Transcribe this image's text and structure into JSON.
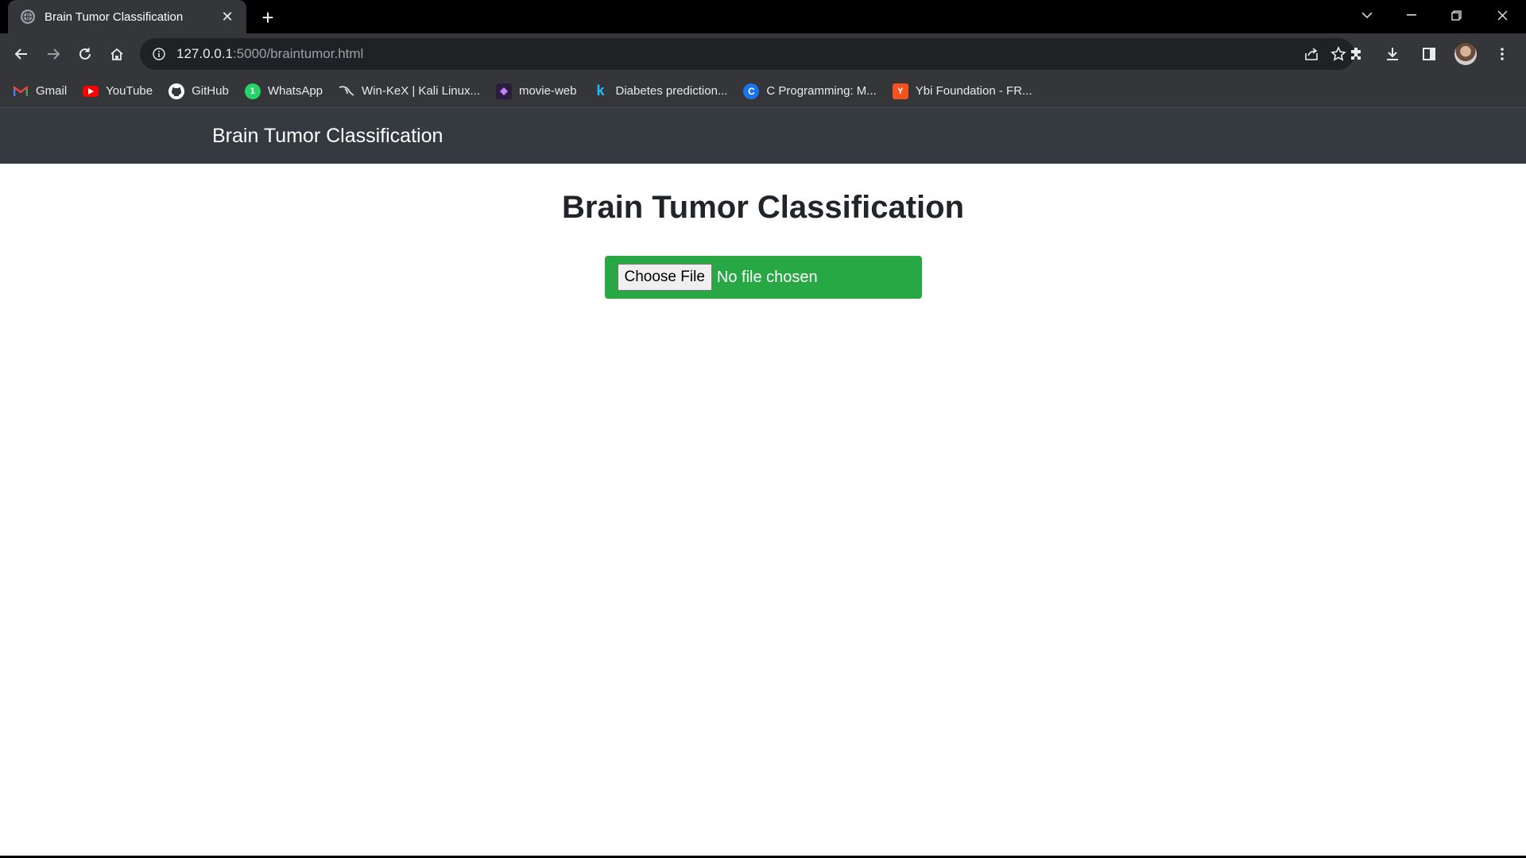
{
  "tab": {
    "title": "Brain Tumor Classification"
  },
  "address_bar": {
    "host": "127.0.0.1",
    "path": ":5000/braintumor.html"
  },
  "bookmarks": [
    {
      "label": "Gmail",
      "icon": "gmail-icon",
      "color": "#ea4335"
    },
    {
      "label": "YouTube",
      "icon": "youtube-icon",
      "color": "#ff0000"
    },
    {
      "label": "GitHub",
      "icon": "github-icon",
      "color": "#ffffff"
    },
    {
      "label": "WhatsApp",
      "icon": "whatsapp-icon",
      "color": "#25d366"
    },
    {
      "label": "Win-KeX | Kali Linux...",
      "icon": "kali-icon",
      "color": "#e8eaed"
    },
    {
      "label": "movie-web",
      "icon": "movie-web-icon",
      "color": "#a855f7"
    },
    {
      "label": "Diabetes prediction...",
      "icon": "kaggle-icon",
      "color": "#20beff"
    },
    {
      "label": "C Programming: M...",
      "icon": "c-programming-icon",
      "color": "#1a73e8"
    },
    {
      "label": "Ybi Foundation - FR...",
      "icon": "ybi-icon",
      "color": "#f4511e"
    }
  ],
  "navbar": {
    "brand": "Brain Tumor Classification",
    "background": "#343a40"
  },
  "main": {
    "heading": "Brain Tumor Classification",
    "file_input": {
      "button_label": "Choose File",
      "status": "No file chosen",
      "background": "#28a745"
    }
  }
}
